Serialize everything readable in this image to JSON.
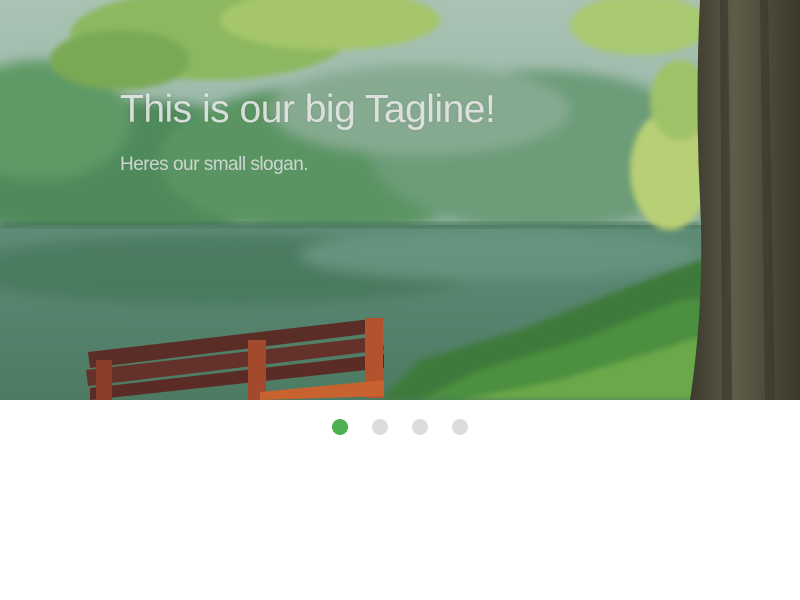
{
  "slider": {
    "slides": [
      {
        "tagline": "This is our big Tagline!",
        "slogan": "Heres our small slogan.",
        "image": "forest-lake-bench-photo"
      }
    ],
    "active_index": 0,
    "dot_count": 4
  },
  "colors": {
    "active_dot": "#4caf50",
    "inactive_dot": "#dcdcdc"
  }
}
